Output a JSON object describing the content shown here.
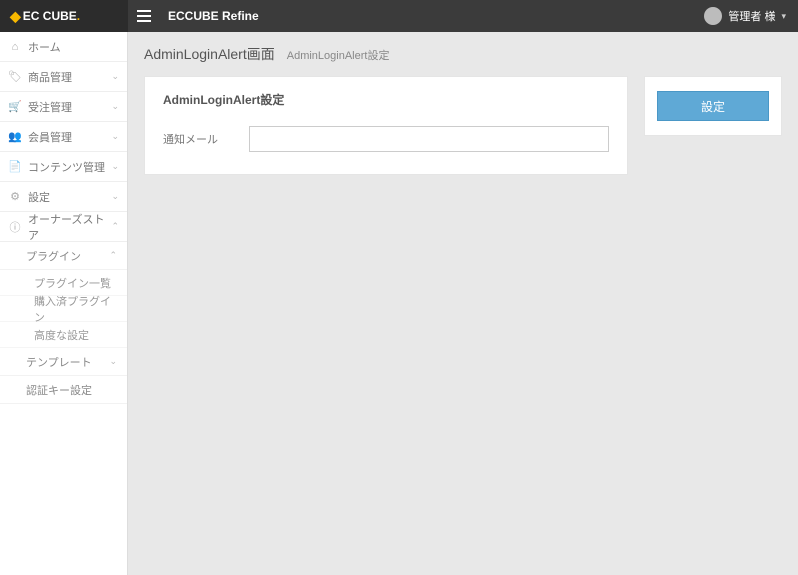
{
  "header": {
    "logo_text": "EC CUBE",
    "app_title": "ECCUBE Refine",
    "user_label": "管理者 様"
  },
  "sidebar": {
    "items": [
      {
        "icon": "home",
        "label": "ホーム",
        "expandable": false
      },
      {
        "icon": "tag",
        "label": "商品管理",
        "expandable": true
      },
      {
        "icon": "cart",
        "label": "受注管理",
        "expandable": true
      },
      {
        "icon": "users",
        "label": "会員管理",
        "expandable": true
      },
      {
        "icon": "file",
        "label": "コンテンツ管理",
        "expandable": true
      },
      {
        "icon": "gear",
        "label": "設定",
        "expandable": true
      },
      {
        "icon": "info",
        "label": "オーナーズストア",
        "expandable": true,
        "open": true,
        "children": [
          {
            "label": "プラグイン",
            "open": true,
            "children": [
              {
                "label": "プラグイン一覧"
              },
              {
                "label": "購入済プラグイン"
              },
              {
                "label": "高度な設定"
              }
            ]
          },
          {
            "label": "テンプレート",
            "open": false,
            "children": []
          },
          {
            "label": "認証キー設定"
          }
        ]
      }
    ]
  },
  "breadcrumb": {
    "title": "AdminLoginAlert画面",
    "sub": "AdminLoginAlert設定"
  },
  "panel": {
    "heading": "AdminLoginAlert設定",
    "field_label": "通知メール",
    "field_value": ""
  },
  "actions": {
    "submit_label": "設定"
  }
}
